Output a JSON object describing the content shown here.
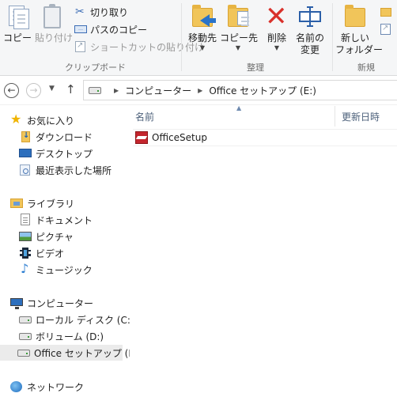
{
  "ribbon": {
    "clipboard": {
      "copy_label": "コピー",
      "paste_label": "貼り付け",
      "cut_label": "切り取り",
      "copy_path_label": "パスのコピー",
      "paste_shortcut_label": "ショートカットの貼り付け",
      "group_label": "クリップボード"
    },
    "organize": {
      "move_to_label": "移動先",
      "copy_to_label": "コピー先",
      "delete_label": "削除",
      "rename_line1": "名前の",
      "rename_line2": "変更",
      "group_label": "整理"
    },
    "new": {
      "new_folder_line1": "新しい",
      "new_folder_line2": "フォルダー",
      "group_label": "新規"
    }
  },
  "address": {
    "crumbs": [
      "コンピューター",
      "Office セットアップ (E:)"
    ]
  },
  "nav": {
    "favorites": {
      "header": "お気に入り",
      "items": [
        "ダウンロード",
        "デスクトップ",
        "最近表示した場所"
      ]
    },
    "libraries": {
      "header": "ライブラリ",
      "items": [
        "ドキュメント",
        "ピクチャ",
        "ビデオ",
        "ミュージック"
      ]
    },
    "computer": {
      "header": "コンピューター",
      "items": [
        "ローカル ディスク (C:)",
        "ボリューム (D:)",
        "Office セットアップ (E:"
      ]
    },
    "network": {
      "header": "ネットワーク"
    }
  },
  "files": {
    "columns": [
      "名前",
      "更新日時"
    ],
    "rows": [
      {
        "name": "OfficeSetup"
      }
    ]
  },
  "colors": {
    "ribbon_bg": "#f5f6f7",
    "selected_nav_bg": "#ebebeb",
    "column_header_text": "#4c607a"
  }
}
